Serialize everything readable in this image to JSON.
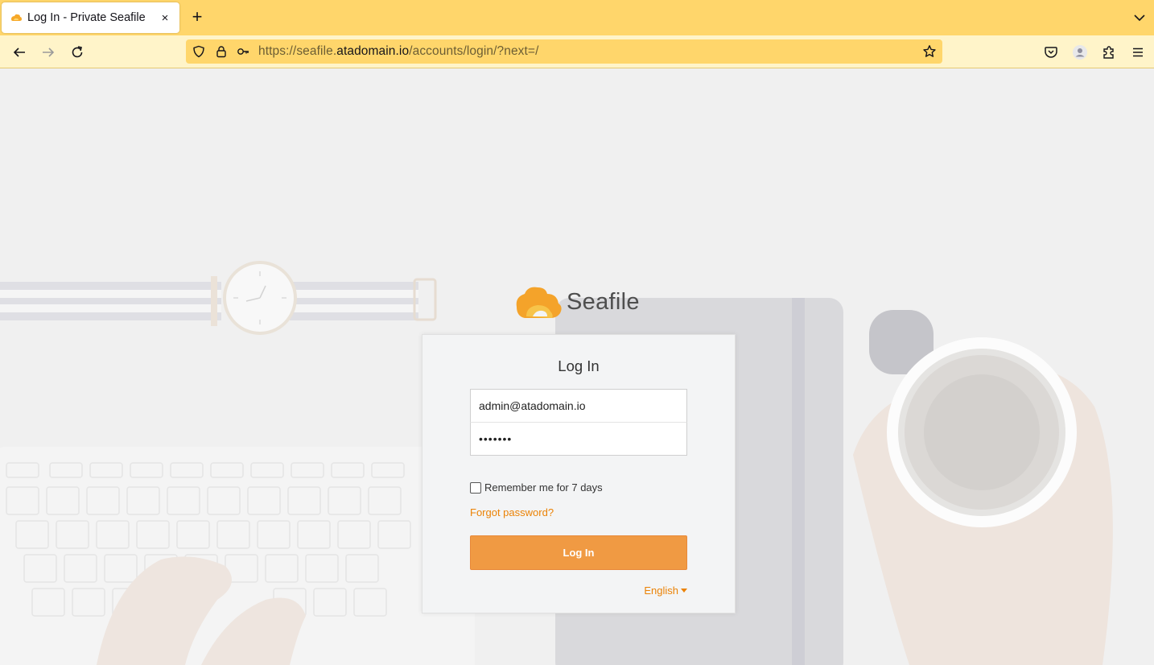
{
  "browser": {
    "tab_title": "Log In - Private Seafile",
    "tab_close": "×",
    "new_tab": "+",
    "url_prefix": "https://seafile.",
    "url_domain": "atadomain.io",
    "url_path": "/accounts/login/?next=/"
  },
  "brand": {
    "name": "Seafile",
    "accent": "#f09a43",
    "link_color": "#eb8205"
  },
  "login": {
    "title": "Log In",
    "username_value": "admin@atadomain.io",
    "password_value": "•••••••",
    "remember_label": "Remember me for 7 days",
    "remember_checked": false,
    "forgot_label": "Forgot password?",
    "submit_label": "Log In",
    "language": "English"
  }
}
